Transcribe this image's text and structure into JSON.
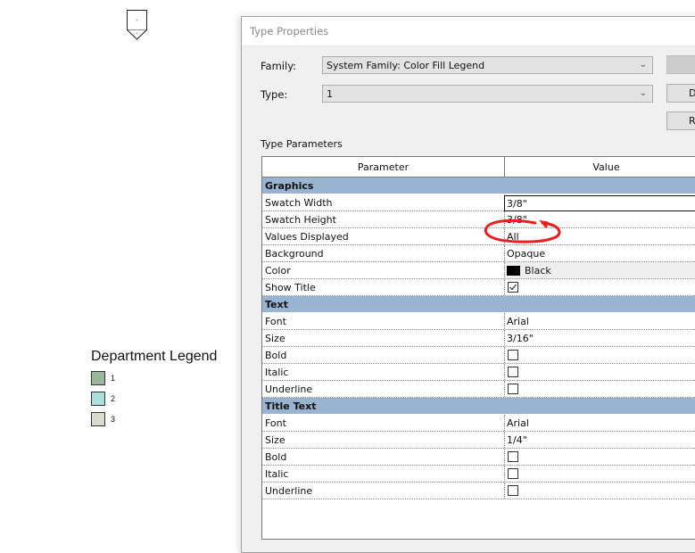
{
  "canvas": {
    "tag_marker_icon": "color-fill-legend-tag",
    "legend": {
      "title": "Department Legend",
      "items": [
        {
          "label": "1",
          "color": "#9bb89a"
        },
        {
          "label": "2",
          "color": "#abdedb"
        },
        {
          "label": "3",
          "color": "#d9dccd"
        }
      ]
    }
  },
  "dialog": {
    "title": "Type Properties",
    "family_label": "Family:",
    "family_value": "System Family: Color Fill Legend",
    "type_label": "Type:",
    "type_value": "1",
    "buttons": [
      "",
      "D",
      "R"
    ],
    "section_label": "Type Parameters",
    "columns": [
      "Parameter",
      "Value"
    ],
    "groups": [
      {
        "name": "Graphics",
        "rows": [
          {
            "param": "Swatch Width",
            "value": "3/8\"",
            "kind": "edit"
          },
          {
            "param": "Swatch Height",
            "value": "3/8\"",
            "kind": "text"
          },
          {
            "param": "Values Displayed",
            "value": "All",
            "kind": "text",
            "annotated": true
          },
          {
            "param": "Background",
            "value": "Opaque",
            "kind": "text"
          },
          {
            "param": "Color",
            "value": "Black",
            "kind": "color",
            "swatch": "#000000"
          },
          {
            "param": "Show Title",
            "value": true,
            "kind": "check"
          }
        ]
      },
      {
        "name": "Text",
        "rows": [
          {
            "param": "Font",
            "value": "Arial",
            "kind": "text"
          },
          {
            "param": "Size",
            "value": "3/16\"",
            "kind": "text"
          },
          {
            "param": "Bold",
            "value": false,
            "kind": "check"
          },
          {
            "param": "Italic",
            "value": false,
            "kind": "check"
          },
          {
            "param": "Underline",
            "value": false,
            "kind": "check"
          }
        ]
      },
      {
        "name": "Title Text",
        "rows": [
          {
            "param": "Font",
            "value": "Arial",
            "kind": "text"
          },
          {
            "param": "Size",
            "value": "1/4\"",
            "kind": "text"
          },
          {
            "param": "Bold",
            "value": false,
            "kind": "check"
          },
          {
            "param": "Italic",
            "value": false,
            "kind": "check"
          },
          {
            "param": "Underline",
            "value": false,
            "kind": "check"
          }
        ]
      }
    ],
    "header_color": "#99b4d1",
    "annotation_color": "#e8201f"
  }
}
